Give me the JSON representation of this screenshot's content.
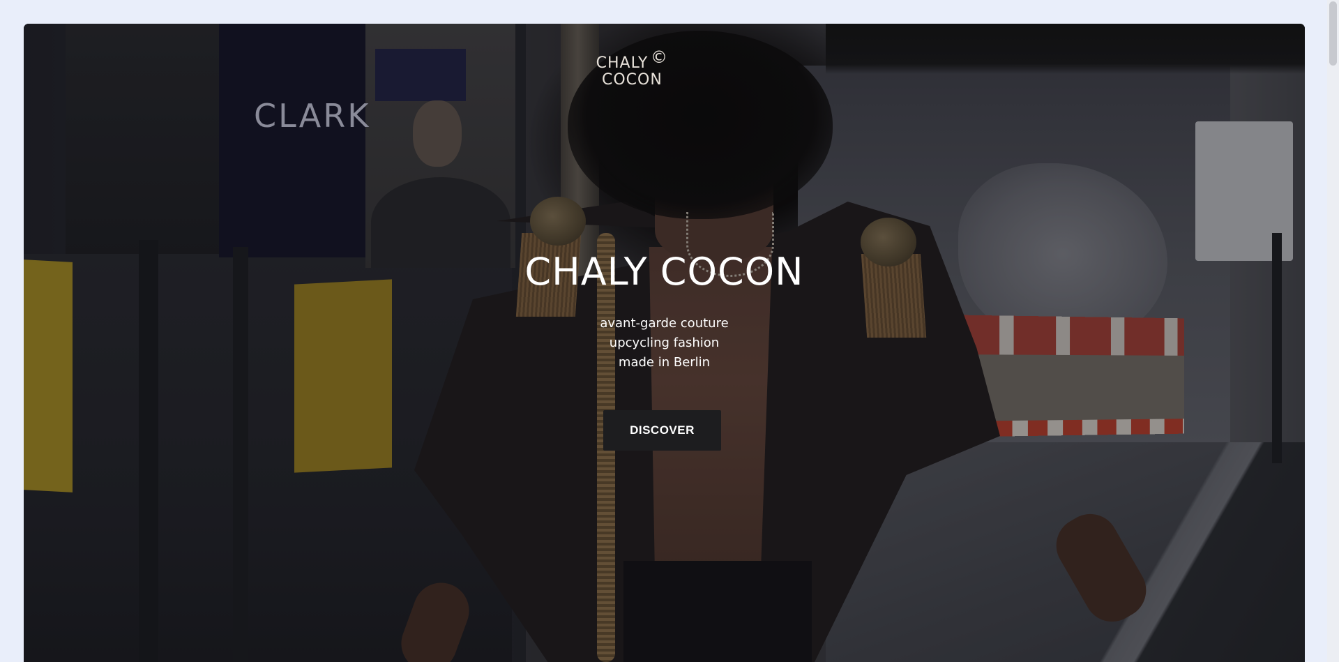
{
  "brand": {
    "logo_line1": "CHALY",
    "logo_line2": "COCON",
    "logo_mark": "©"
  },
  "hero": {
    "headline": "CHALY COCON",
    "tagline": [
      "avant-garde couture",
      "upcycling fashion",
      "made in Berlin"
    ],
    "cta_label": "DISCOVER",
    "background_image": "photo of a model in an open black jacket with gold epaulettes and braided cord, walking through a graffiti-covered underpass in Berlin",
    "poster_text": "CLARK"
  },
  "colors": {
    "page_background": "#e9eefa",
    "button_background": "#1d1d1f",
    "button_text": "#ffffff",
    "headline_text": "#ffffff"
  }
}
